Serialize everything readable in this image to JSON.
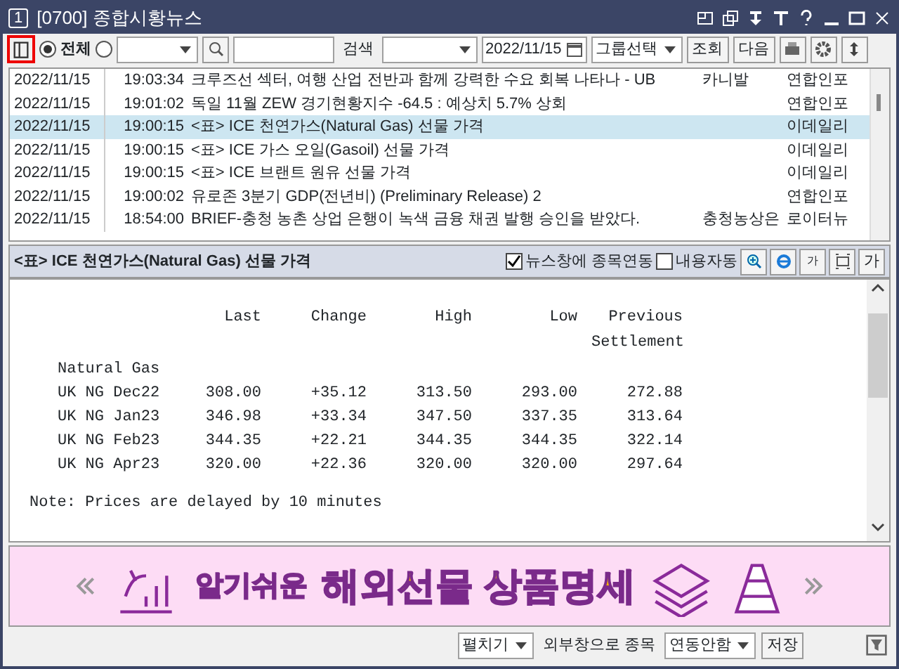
{
  "window": {
    "number": "1",
    "title": "[0700] 종합시황뉴스"
  },
  "toolbar": {
    "scope_radios": [
      {
        "label": "전체",
        "selected": true
      },
      {
        "selected": false
      }
    ],
    "search_label": "검색",
    "date": "2022/11/15",
    "group_select": "그룹선택",
    "buttons": [
      "조회",
      "다음"
    ]
  },
  "news": [
    {
      "date": "2022/11/15",
      "time": "19:03:34",
      "title": "크루즈선 섹터, 여행 산업 전반과 함께 강력한 수요 회복 나타나 - UB",
      "stock": "카니발",
      "source": "연합인포",
      "selected": false
    },
    {
      "date": "2022/11/15",
      "time": "19:01:02",
      "title": "독일 11월 ZEW 경기현황지수 -64.5 : 예상치 5.7% 상회",
      "source": "연합인포",
      "selected": false
    },
    {
      "date": "2022/11/15",
      "time": "19:00:15",
      "title": "<표> ICE 천연가스(Natural Gas) 선물 가격",
      "source": "이데일리",
      "selected": true
    },
    {
      "date": "2022/11/15",
      "time": "19:00:15",
      "title": "<표> ICE 가스 오일(Gasoil) 선물 가격",
      "source": "이데일리",
      "selected": false
    },
    {
      "date": "2022/11/15",
      "time": "19:00:15",
      "title": "<표> ICE 브랜트 원유 선물 가격",
      "source": "이데일리",
      "selected": false
    },
    {
      "date": "2022/11/15",
      "time": "19:00:02",
      "title": "유로존 3분기 GDP(전년비) (Preliminary Release) 2",
      "source": "연합인포",
      "selected": false
    },
    {
      "date": "2022/11/15",
      "time": "18:54:00",
      "title": "BRIEF-충청 농촌 상업 은행이 녹색 금융 채권 발행 승인을 받았다.",
      "stock": "충청농상은",
      "source": "로이터뉴",
      "selected": false
    }
  ],
  "article": {
    "title": "<표> ICE 천연가스(Natural Gas) 선물 가격",
    "checkboxes": [
      {
        "label": "뉴스창에 종목연동",
        "checked": true
      },
      {
        "label": "내용자동",
        "checked": false
      }
    ],
    "font_buttons": [
      "가",
      "가"
    ],
    "columns": [
      "Last",
      "Change",
      "High",
      "Low",
      "Previous Settlement"
    ],
    "group": "Natural Gas",
    "rows": [
      {
        "name": "UK NG Dec22",
        "values": [
          "308.00",
          "+35.12",
          "313.50",
          "293.00",
          "272.88"
        ]
      },
      {
        "name": "UK NG Jan23",
        "values": [
          "346.98",
          "+33.34",
          "347.50",
          "337.35",
          "313.64"
        ]
      },
      {
        "name": "UK NG Feb23",
        "values": [
          "344.35",
          "+22.21",
          "344.35",
          "344.35",
          "322.14"
        ]
      },
      {
        "name": "UK NG Apr23",
        "values": [
          "320.00",
          "+22.36",
          "320.00",
          "320.00",
          "297.64"
        ]
      }
    ],
    "note": "Note: Prices are delayed by 10 minutes"
  },
  "banner": {
    "text_1": "알기쉬운",
    "text_2": "해외선물 상품명세"
  },
  "footer": {
    "expand_select": "펼치기",
    "link_label": "외부창으로 종목",
    "link_select": "연동안함",
    "save": "저장"
  }
}
